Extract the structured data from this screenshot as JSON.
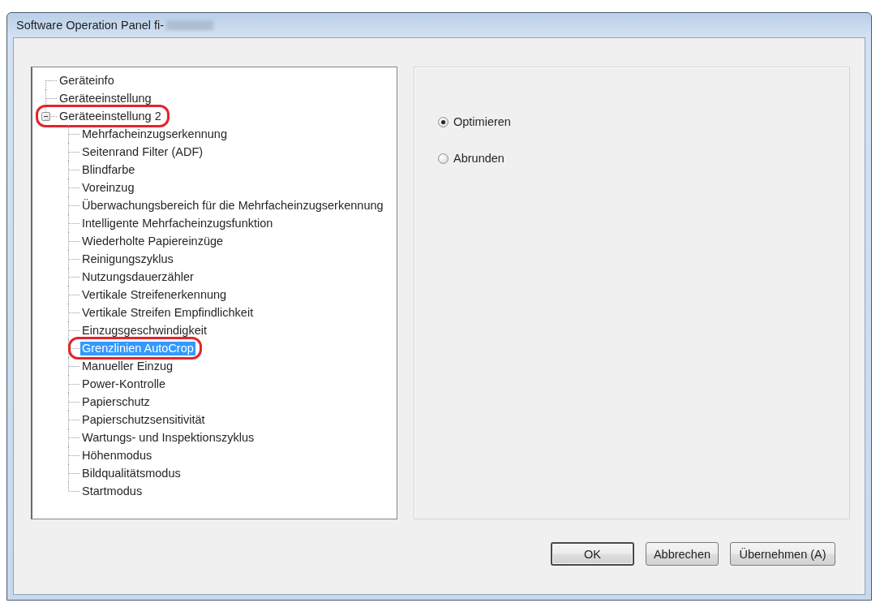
{
  "window": {
    "title": "Software Operation Panel fi-"
  },
  "tree": {
    "items": [
      {
        "label": "Geräteinfo",
        "selected": false,
        "circled": false
      },
      {
        "label": "Geräteeinstellung",
        "selected": false,
        "circled": false
      },
      {
        "label": "Geräteeinstellung 2",
        "selected": false,
        "circled": true,
        "expanded": true,
        "children": [
          {
            "label": "Mehrfacheinzugserkennung",
            "selected": false,
            "circled": false
          },
          {
            "label": "Seitenrand Filter (ADF)",
            "selected": false,
            "circled": false
          },
          {
            "label": "Blindfarbe",
            "selected": false,
            "circled": false
          },
          {
            "label": "Voreinzug",
            "selected": false,
            "circled": false
          },
          {
            "label": "Überwachungsbereich für die Mehrfacheinzugserkennung",
            "selected": false,
            "circled": false
          },
          {
            "label": "Intelligente Mehrfacheinzugsfunktion",
            "selected": false,
            "circled": false
          },
          {
            "label": "Wiederholte Papiereinzüge",
            "selected": false,
            "circled": false
          },
          {
            "label": "Reinigungszyklus",
            "selected": false,
            "circled": false
          },
          {
            "label": "Nutzungsdauerzähler",
            "selected": false,
            "circled": false
          },
          {
            "label": "Vertikale Streifenerkennung",
            "selected": false,
            "circled": false
          },
          {
            "label": "Vertikale Streifen Empfindlichkeit",
            "selected": false,
            "circled": false
          },
          {
            "label": "Einzugsgeschwindigkeit",
            "selected": false,
            "circled": false
          },
          {
            "label": "Grenzlinien AutoCrop",
            "selected": true,
            "circled": true
          },
          {
            "label": "Manueller Einzug",
            "selected": false,
            "circled": false
          },
          {
            "label": "Power-Kontrolle",
            "selected": false,
            "circled": false
          },
          {
            "label": "Papierschutz",
            "selected": false,
            "circled": false
          },
          {
            "label": "Papierschutzsensitivität",
            "selected": false,
            "circled": false
          },
          {
            "label": "Wartungs- und Inspektionszyklus",
            "selected": false,
            "circled": false
          },
          {
            "label": "Höhenmodus",
            "selected": false,
            "circled": false
          },
          {
            "label": "Bildqualitätsmodus",
            "selected": false,
            "circled": false
          },
          {
            "label": "Startmodus",
            "selected": false,
            "circled": false
          }
        ]
      }
    ]
  },
  "options": {
    "radios": [
      {
        "label": "Optimieren",
        "selected": true
      },
      {
        "label": "Abrunden",
        "selected": false
      }
    ]
  },
  "buttons": [
    {
      "label": "OK",
      "default": true
    },
    {
      "label": "Abbrechen",
      "default": false
    },
    {
      "label": "Übernehmen (A)",
      "default": false
    }
  ]
}
